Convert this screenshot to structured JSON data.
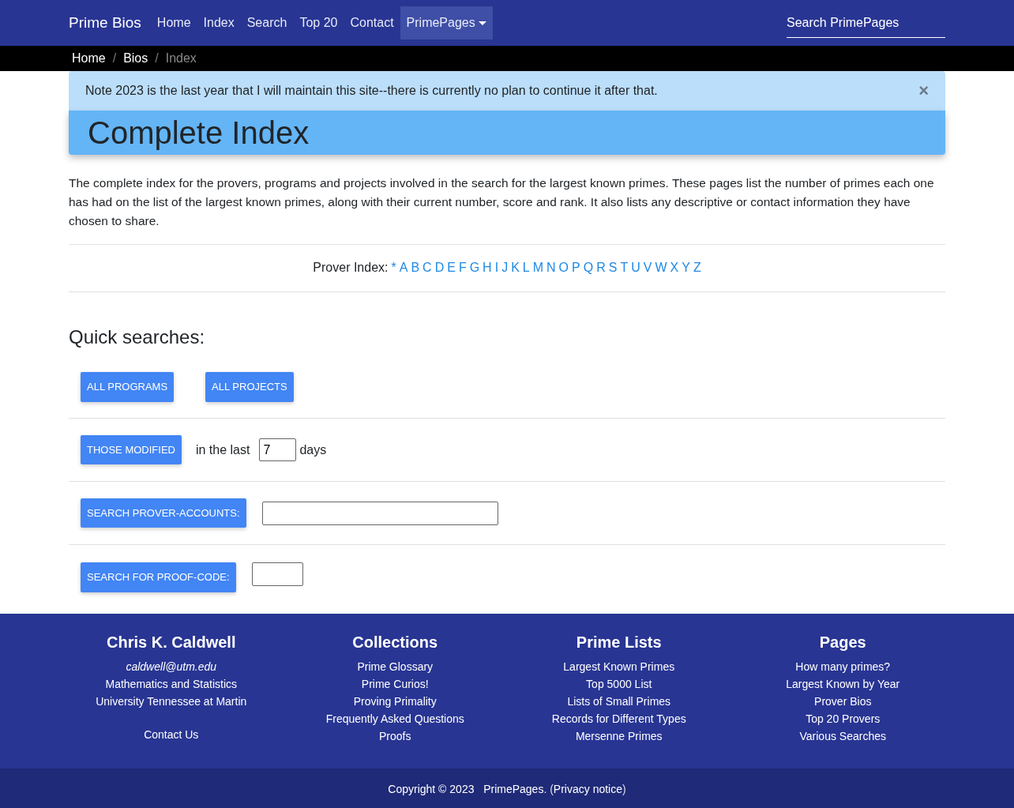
{
  "navbar": {
    "brand": "Prime Bios",
    "links": [
      {
        "label": "Home",
        "selected": false
      },
      {
        "label": "Index",
        "selected": false
      },
      {
        "label": "Search",
        "selected": false
      },
      {
        "label": "Top 20",
        "selected": false
      },
      {
        "label": "Contact",
        "selected": false
      },
      {
        "label": "PrimePages",
        "selected": true,
        "kind": "dropdown"
      }
    ],
    "search": {
      "placeholder": "Search PrimePages"
    }
  },
  "breadcrumb": [
    {
      "label": "Home",
      "current": false
    },
    {
      "label": "/",
      "kind": "separator"
    },
    {
      "label": "Bios",
      "current": false
    },
    {
      "label": "/",
      "kind": "separator"
    },
    {
      "label": "Index",
      "current": true
    }
  ],
  "alert": {
    "text": "Note 2023 is the last year that I will maintain this site--there is currently no plan to continue it after that.",
    "close": "×"
  },
  "title": "Complete Index",
  "intro": "The complete index for the provers, programs and projects involved in the search for the largest known primes. These pages list the number of primes each one has had on the list of the largest known primes, along with their current number, score and rank. It also lists any descriptive or contact information they have chosen to share.",
  "prover_index": {
    "label": "Prover Index:",
    "letters": [
      "*",
      "A",
      "B",
      "C",
      "D",
      "E",
      "F",
      "G",
      "H",
      "I",
      "J",
      "K",
      "L",
      "M",
      "N",
      "O",
      "P",
      "Q",
      "R",
      "S",
      "T",
      "U",
      "V",
      "W",
      "X",
      "Y",
      "Z"
    ]
  },
  "quick_searches": {
    "title": "Quick searches:",
    "rows": [
      {
        "kind": "buttons",
        "buttons": [
          "ALL PROGRAMS",
          "ALL PROJECTS"
        ]
      },
      {
        "kind": "modified",
        "button": "THOSE MODIFIED",
        "before": "in the last",
        "value": "7",
        "after": "days"
      },
      {
        "kind": "search",
        "button": "SEARCH PROVER-ACCOUNTS:"
      },
      {
        "kind": "code",
        "button": "SEARCH FOR PROOF-CODE:"
      }
    ]
  },
  "footer": {
    "columns": [
      {
        "title": "Chris K. Caldwell",
        "items": [
          {
            "text": "caldwell@utm.edu",
            "kind": "email"
          },
          {
            "text": "Mathematics and Statistics",
            "kind": "text"
          },
          {
            "text": "University Tennessee at Martin",
            "kind": "text"
          },
          {
            "text": "Contact Us",
            "kind": "spaced-link"
          }
        ]
      },
      {
        "title": "Collections",
        "items": [
          {
            "text": "Prime Glossary",
            "kind": "link"
          },
          {
            "text": "Prime Curios!",
            "kind": "link"
          },
          {
            "text": "Proving Primality",
            "kind": "link"
          },
          {
            "text": "Frequently Asked Questions",
            "kind": "link"
          },
          {
            "text": "Proofs",
            "kind": "link"
          }
        ]
      },
      {
        "title": "Prime Lists",
        "items": [
          {
            "text": "Largest Known Primes",
            "kind": "link"
          },
          {
            "text": "Top 5000 List",
            "kind": "link"
          },
          {
            "text": "Lists of Small Primes",
            "kind": "link"
          },
          {
            "text": "Records for Different Types",
            "kind": "link"
          },
          {
            "text": "Mersenne Primes",
            "kind": "link"
          }
        ]
      },
      {
        "title": "Pages",
        "items": [
          {
            "text": "How many primes?",
            "kind": "link"
          },
          {
            "text": "Largest Known by Year",
            "kind": "link"
          },
          {
            "text": "Prover Bios",
            "kind": "link"
          },
          {
            "text": "Top 20 Provers",
            "kind": "link"
          },
          {
            "text": "Various Searches",
            "kind": "link"
          }
        ]
      }
    ],
    "copyright": {
      "text": "Copyright © 2023",
      "site": "PrimePages",
      "separator": ".  (",
      "privacy": "Privacy notice",
      "end": ")"
    }
  }
}
